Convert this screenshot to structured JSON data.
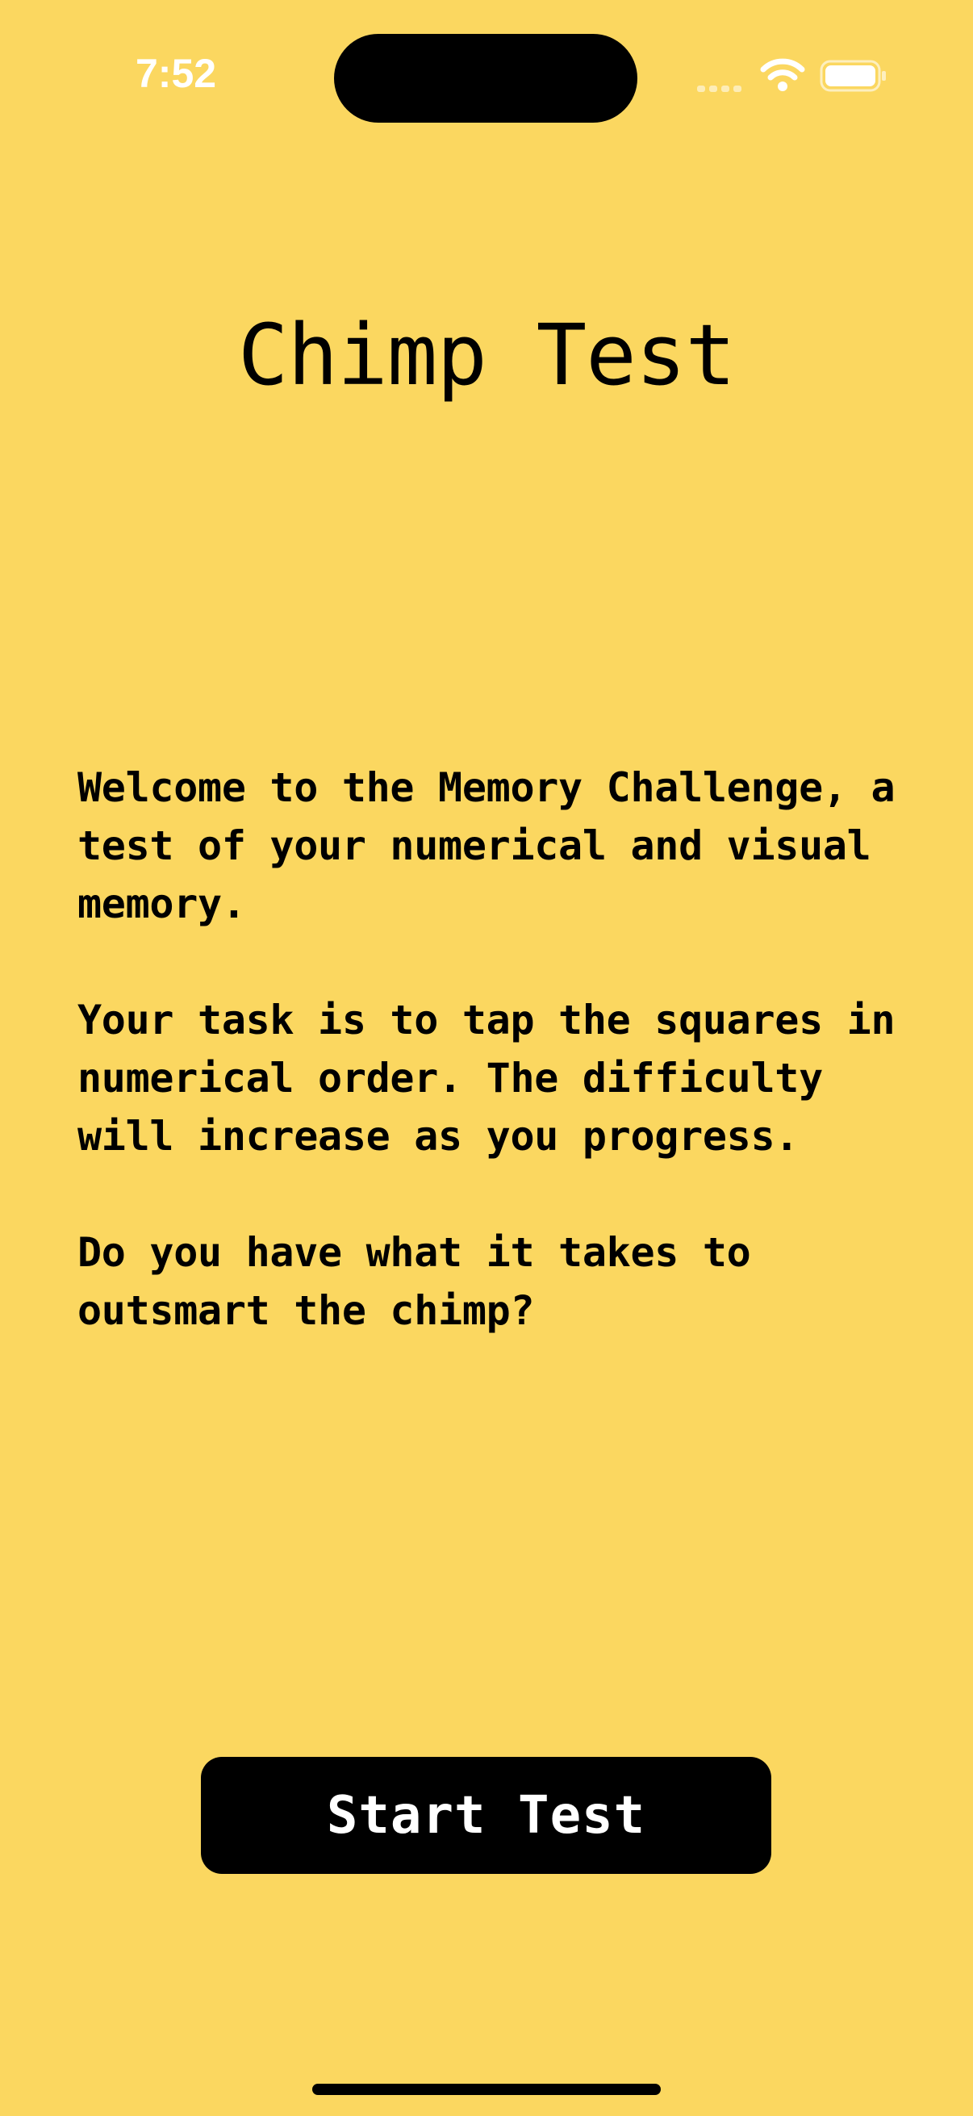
{
  "status_bar": {
    "time": "7:52",
    "icons": [
      "signal-icon",
      "wifi-icon",
      "battery-icon"
    ]
  },
  "page": {
    "title": "Chimp Test",
    "paragraphs": [
      "Welcome to the Memory Challenge, a test of your numerical and visual memory.",
      "Your task is to tap the squares in numerical order. The difficulty will increase as you progress.",
      "Do you have what it takes to outsmart the chimp?"
    ],
    "start_button_label": "Start Test"
  },
  "colors": {
    "background": "#FBD760",
    "text": "#000000",
    "button_background": "#000000",
    "button_text": "#FFFFFF"
  }
}
